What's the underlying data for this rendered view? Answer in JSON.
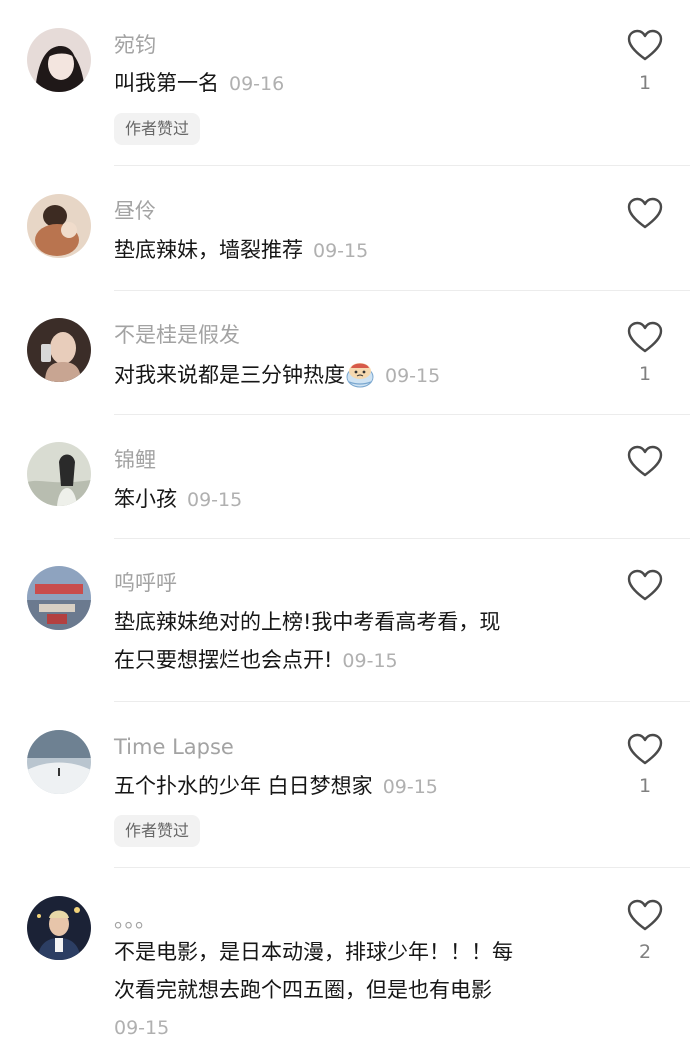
{
  "comments": [
    {
      "username": "宛钧",
      "text": "叫我第一名",
      "date": "09-16",
      "likes": "1",
      "badge": "作者赞过",
      "avatar_colors": [
        "#d9c8c4",
        "#2a2222"
      ]
    },
    {
      "username": "昼伶",
      "text": "垫底辣妹，墙裂推荐",
      "date": "09-15",
      "likes": "",
      "badge": "",
      "avatar_colors": [
        "#d8c3b1",
        "#b0704e"
      ]
    },
    {
      "username": "不是桂是假发",
      "text": "对我来说都是三分钟热度",
      "date": "09-15",
      "likes": "1",
      "badge": "",
      "avatar_colors": [
        "#5b463c",
        "#e0c7b4"
      ],
      "emoji": "crying-face-emoji"
    },
    {
      "username": "锦鲤",
      "text": "笨小孩",
      "date": "09-15",
      "likes": "",
      "badge": "",
      "avatar_colors": [
        "#cfd1c6",
        "#2b2b2b"
      ]
    },
    {
      "username": "呜呼呼",
      "text_lines": [
        "垫底辣妹绝对的上榜!我中考看高考看，现",
        "在只要想摆烂也会点开!"
      ],
      "date": "09-15",
      "likes": "",
      "badge": "",
      "avatar_colors": [
        "#7c8ea9",
        "#c94d4d"
      ]
    },
    {
      "username": "Time Lapse",
      "text": "五个扑水的少年 白日梦想家",
      "date": "09-15",
      "likes": "1",
      "badge": "作者赞过",
      "avatar_colors": [
        "#a8b6c3",
        "#eef0f2"
      ]
    },
    {
      "username": "。。。",
      "text_lines": [
        "不是电影，是日本动漫，排球少年！！！每",
        "次看完就想去跑个四五圈，但是也有电影"
      ],
      "date": "09-15",
      "likes": "2",
      "badge": "",
      "avatar_colors": [
        "#1b2236",
        "#e2c0a5"
      ]
    }
  ],
  "icons": {
    "like": "heart-outline-icon"
  }
}
